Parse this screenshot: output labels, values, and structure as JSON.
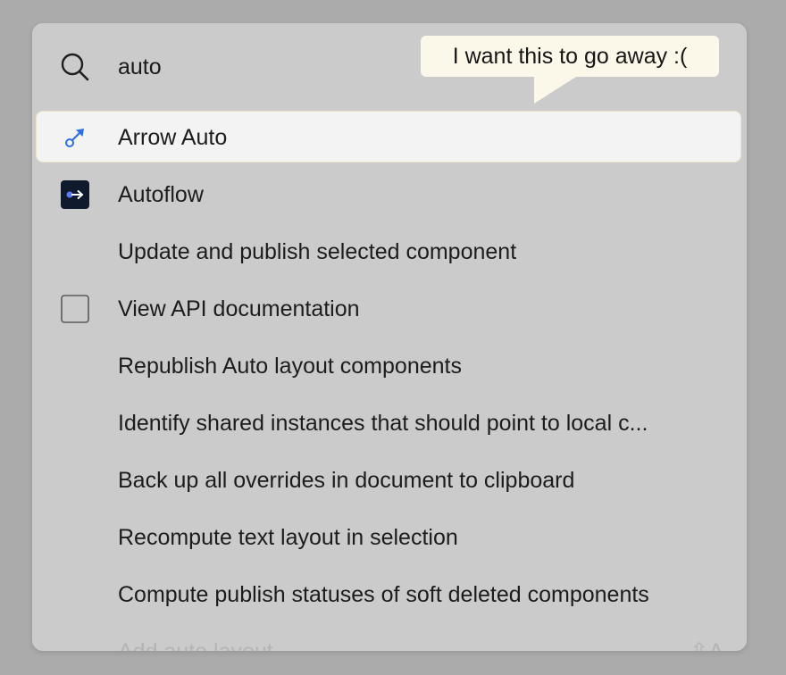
{
  "search": {
    "value": "auto",
    "icon": "search-icon"
  },
  "tooltip": {
    "text": "I want this to go away :("
  },
  "results": [
    {
      "label": "Arrow Auto",
      "icon": "arrow-auto-icon",
      "selected": true
    },
    {
      "label": "Autoflow",
      "icon": "autoflow-icon"
    },
    {
      "label": "Update and publish selected component"
    },
    {
      "label": "View API documentation",
      "icon": "checkbox-icon"
    },
    {
      "label": "Republish Auto layout components"
    },
    {
      "label": "Identify shared instances that should point to local c..."
    },
    {
      "label": "Back up all overrides in document to clipboard"
    },
    {
      "label": "Recompute text layout in selection"
    },
    {
      "label": "Compute publish statuses of soft deleted components"
    },
    {
      "label": "Add auto layout",
      "shortcut": "⇧A"
    }
  ],
  "colors": {
    "palette_bg": "#cbcbcb",
    "selected_bg": "#f3f3f3",
    "tooltip_bg": "#fbf8ea",
    "arrow_accent": "#2f6fe0",
    "autoflow_bg": "#0f1b2d"
  }
}
